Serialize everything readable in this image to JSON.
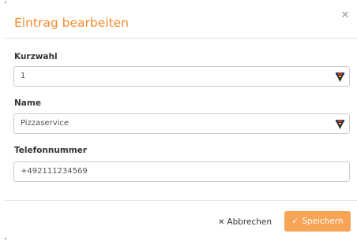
{
  "dialog": {
    "title": "Eintrag bearbeiten",
    "close_icon": "close-icon"
  },
  "fields": {
    "kurzwahl": {
      "label": "Kurzwahl",
      "value": "1",
      "icon": "password-manager-icon"
    },
    "name": {
      "label": "Name",
      "value": "Pizzaservice",
      "icon": "password-manager-icon"
    },
    "telefonnummer": {
      "label": "Telefonnummer",
      "value": "+492111234569"
    }
  },
  "footer": {
    "cancel_label": "Abbrechen",
    "cancel_icon": "close-icon",
    "save_label": "Speichern",
    "save_icon": "checkmark-icon"
  },
  "colors": {
    "accent": "#f58a2c",
    "save_button": "#f8a457",
    "border": "#cccccc",
    "divider": "#e5e5e5"
  }
}
